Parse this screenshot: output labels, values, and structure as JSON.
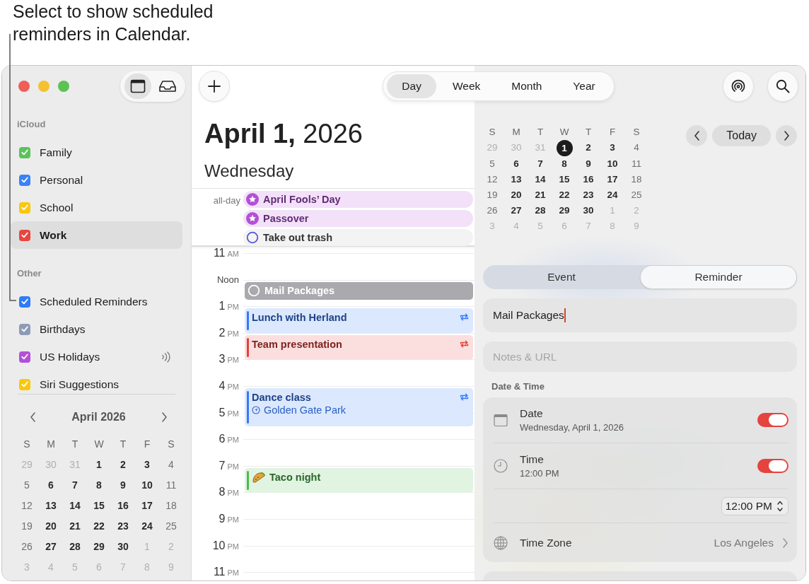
{
  "callout": {
    "text": "Select to show scheduled reminders in Calendar."
  },
  "sidebar": {
    "view_buttons": [
      {
        "kind": "calendar",
        "selected": true
      },
      {
        "kind": "inbox",
        "selected": false
      }
    ],
    "groups": [
      {
        "title": "iCloud",
        "items": [
          {
            "name": "Family",
            "color": "#5ac35a",
            "checked": true,
            "selected": false,
            "subscribed": false
          },
          {
            "name": "Personal",
            "color": "#3b82f6",
            "checked": true,
            "selected": false,
            "subscribed": false
          },
          {
            "name": "School",
            "color": "#f9c80e",
            "checked": true,
            "selected": false,
            "subscribed": false
          },
          {
            "name": "Work",
            "color": "#e9453f",
            "checked": true,
            "selected": true,
            "subscribed": false
          }
        ]
      },
      {
        "title": "Other",
        "items": [
          {
            "name": "Scheduled Reminders",
            "color": "#2f7cf6",
            "checked": true,
            "selected": false,
            "subscribed": false
          },
          {
            "name": "Birthdays",
            "color": "#8e9bb5",
            "checked": true,
            "selected": false,
            "subscribed": false
          },
          {
            "name": "US Holidays",
            "color": "#b44fd7",
            "checked": true,
            "selected": false,
            "subscribed": true
          },
          {
            "name": "Siri Suggestions",
            "color": "#f9c80e",
            "checked": true,
            "selected": false,
            "subscribed": false
          }
        ]
      }
    ],
    "mini_calendar": {
      "title": "April 2026",
      "weekdays": [
        "S",
        "M",
        "T",
        "W",
        "T",
        "F",
        "S"
      ],
      "weeks": [
        [
          {
            "d": "29",
            "kind": "other"
          },
          {
            "d": "30",
            "kind": "other"
          },
          {
            "d": "31",
            "kind": "other"
          },
          {
            "d": "1",
            "kind": "weekday"
          },
          {
            "d": "2",
            "kind": "weekday"
          },
          {
            "d": "3",
            "kind": "weekday"
          },
          {
            "d": "4",
            "kind": "weekend"
          }
        ],
        [
          {
            "d": "5",
            "kind": "weekend"
          },
          {
            "d": "6",
            "kind": "weekday"
          },
          {
            "d": "7",
            "kind": "weekday"
          },
          {
            "d": "8",
            "kind": "weekday"
          },
          {
            "d": "9",
            "kind": "weekday"
          },
          {
            "d": "10",
            "kind": "weekday"
          },
          {
            "d": "11",
            "kind": "weekend"
          }
        ],
        [
          {
            "d": "12",
            "kind": "weekend"
          },
          {
            "d": "13",
            "kind": "weekday"
          },
          {
            "d": "14",
            "kind": "weekday"
          },
          {
            "d": "15",
            "kind": "weekday"
          },
          {
            "d": "16",
            "kind": "weekday"
          },
          {
            "d": "17",
            "kind": "weekday"
          },
          {
            "d": "18",
            "kind": "weekend"
          }
        ],
        [
          {
            "d": "19",
            "kind": "weekend"
          },
          {
            "d": "20",
            "kind": "weekday"
          },
          {
            "d": "21",
            "kind": "weekday"
          },
          {
            "d": "22",
            "kind": "weekday"
          },
          {
            "d": "23",
            "kind": "weekday"
          },
          {
            "d": "24",
            "kind": "weekday"
          },
          {
            "d": "25",
            "kind": "weekend"
          }
        ],
        [
          {
            "d": "26",
            "kind": "weekend"
          },
          {
            "d": "27",
            "kind": "weekday"
          },
          {
            "d": "28",
            "kind": "weekday"
          },
          {
            "d": "29",
            "kind": "weekday"
          },
          {
            "d": "30",
            "kind": "weekday"
          },
          {
            "d": "1",
            "kind": "other"
          },
          {
            "d": "2",
            "kind": "other"
          }
        ],
        [
          {
            "d": "3",
            "kind": "other"
          },
          {
            "d": "4",
            "kind": "other"
          },
          {
            "d": "5",
            "kind": "other"
          },
          {
            "d": "6",
            "kind": "other"
          },
          {
            "d": "7",
            "kind": "other"
          },
          {
            "d": "8",
            "kind": "other"
          },
          {
            "d": "9",
            "kind": "other"
          }
        ]
      ]
    }
  },
  "toolbar": {
    "views": [
      {
        "label": "Day",
        "selected": true
      },
      {
        "label": "Week",
        "selected": false
      },
      {
        "label": "Month",
        "selected": false
      },
      {
        "label": "Year",
        "selected": false
      }
    ]
  },
  "day_view": {
    "date": "**April 1,** 2026",
    "weekday": "Wednesday",
    "all_day_label": "all-day",
    "all_day": [
      {
        "title": "April Fools’ Day",
        "kind": "holiday",
        "color": "#b44fd7",
        "selected": false
      },
      {
        "title": "Passover",
        "kind": "holiday",
        "color": "#b44fd7",
        "selected": false
      },
      {
        "title": "Take out trash",
        "kind": "reminder",
        "color": "#5856d6",
        "selected": false
      }
    ],
    "hours": [
      {
        "hour": "11",
        "suffix": "AM"
      },
      {
        "hour": "Noon",
        "events": [
          {
            "title": "Mail Packages",
            "kind": "reminder",
            "selected": true
          }
        ]
      },
      {
        "hour": "1",
        "suffix": "PM",
        "events": [
          {
            "title": "Lunch with Herland",
            "kind": "event",
            "color": "#3478f6",
            "selected": false,
            "repeats": true,
            "has_icon": false
          }
        ]
      },
      {
        "hour": "2",
        "suffix": "PM",
        "events": [
          {
            "title": "Team presentation",
            "kind": "event",
            "color": "#e5403a",
            "selected": false,
            "repeats": true,
            "has_icon": false
          }
        ]
      },
      {
        "hour": "3",
        "suffix": "PM"
      },
      {
        "hour": "4",
        "suffix": "PM",
        "events": [
          {
            "title": "Dance class",
            "kind": "event",
            "color": "#3478f6",
            "selected": false,
            "repeats": true,
            "has_icon": false,
            "location": "Golden Gate Park"
          }
        ]
      },
      {
        "hour": "5",
        "suffix": "PM"
      },
      {
        "hour": "6",
        "suffix": "PM"
      },
      {
        "hour": "7",
        "suffix": "PM",
        "events": [
          {
            "title": "Taco night",
            "kind": "event",
            "color": "#4cbb4c",
            "selected": false,
            "repeats": false,
            "has_icon": true
          }
        ]
      },
      {
        "hour": "8",
        "suffix": "PM"
      },
      {
        "hour": "9",
        "suffix": "PM"
      },
      {
        "hour": "10",
        "suffix": "PM"
      },
      {
        "hour": "11",
        "suffix": "PM"
      }
    ]
  },
  "inspector": {
    "calendar": {
      "weekdays": [
        "S",
        "M",
        "T",
        "W",
        "T",
        "F",
        "S"
      ],
      "weeks": [
        [
          {
            "d": "29",
            "kind": "other",
            "selected": false
          },
          {
            "d": "30",
            "kind": "other",
            "selected": false
          },
          {
            "d": "31",
            "kind": "other",
            "selected": false
          },
          {
            "d": "1",
            "kind": "weekday",
            "selected": true
          },
          {
            "d": "2",
            "kind": "weekday",
            "selected": false
          },
          {
            "d": "3",
            "kind": "weekday",
            "selected": false
          },
          {
            "d": "4",
            "kind": "weekend",
            "selected": false
          }
        ],
        [
          {
            "d": "5",
            "kind": "weekend",
            "selected": false
          },
          {
            "d": "6",
            "kind": "weekday",
            "selected": false
          },
          {
            "d": "7",
            "kind": "weekday",
            "selected": false
          },
          {
            "d": "8",
            "kind": "weekday",
            "selected": false
          },
          {
            "d": "9",
            "kind": "weekday",
            "selected": false
          },
          {
            "d": "10",
            "kind": "weekday",
            "selected": false
          },
          {
            "d": "11",
            "kind": "weekend",
            "selected": false
          }
        ],
        [
          {
            "d": "12",
            "kind": "weekend",
            "selected": false
          },
          {
            "d": "13",
            "kind": "weekday",
            "selected": false
          },
          {
            "d": "14",
            "kind": "weekday",
            "selected": false
          },
          {
            "d": "15",
            "kind": "weekday",
            "selected": false
          },
          {
            "d": "16",
            "kind": "weekday",
            "selected": false
          },
          {
            "d": "17",
            "kind": "weekday",
            "selected": false
          },
          {
            "d": "18",
            "kind": "weekend",
            "selected": false
          }
        ],
        [
          {
            "d": "19",
            "kind": "weekend",
            "selected": false
          },
          {
            "d": "20",
            "kind": "weekday",
            "selected": false
          },
          {
            "d": "21",
            "kind": "weekday",
            "selected": false
          },
          {
            "d": "22",
            "kind": "weekday",
            "selected": false
          },
          {
            "d": "23",
            "kind": "weekday",
            "selected": false
          },
          {
            "d": "24",
            "kind": "weekday",
            "selected": false
          },
          {
            "d": "25",
            "kind": "weekend",
            "selected": false
          }
        ],
        [
          {
            "d": "26",
            "kind": "weekend",
            "selected": false
          },
          {
            "d": "27",
            "kind": "weekday",
            "selected": false
          },
          {
            "d": "28",
            "kind": "weekday",
            "selected": false
          },
          {
            "d": "29",
            "kind": "weekday",
            "selected": false
          },
          {
            "d": "30",
            "kind": "weekday",
            "selected": false
          },
          {
            "d": "1",
            "kind": "other",
            "selected": false
          },
          {
            "d": "2",
            "kind": "other",
            "selected": false
          }
        ],
        [
          {
            "d": "3",
            "kind": "other",
            "selected": false
          },
          {
            "d": "4",
            "kind": "other",
            "selected": false
          },
          {
            "d": "5",
            "kind": "other",
            "selected": false
          },
          {
            "d": "6",
            "kind": "other",
            "selected": false
          },
          {
            "d": "7",
            "kind": "other",
            "selected": false
          },
          {
            "d": "8",
            "kind": "other",
            "selected": false
          },
          {
            "d": "9",
            "kind": "other",
            "selected": false
          }
        ]
      ]
    },
    "today_button": "Today",
    "modes": [
      {
        "label": "Event",
        "selected": false
      },
      {
        "label": "Reminder",
        "selected": true
      }
    ],
    "title_field": {
      "value": "Mail Packages"
    },
    "notes_field": {
      "placeholder": "Notes & URL"
    },
    "section_title": "Date & Time",
    "rows": [
      {
        "kind": "date",
        "label": "Date",
        "detail": "Wednesday, April 1, 2026",
        "on": true
      },
      {
        "kind": "time",
        "label": "Time",
        "detail": "12:00 PM",
        "on": true
      },
      {
        "kind": "stepper",
        "value": "12:00 PM"
      },
      {
        "kind": "timezone",
        "label": "Time Zone",
        "value": "Los Angeles"
      }
    ]
  }
}
